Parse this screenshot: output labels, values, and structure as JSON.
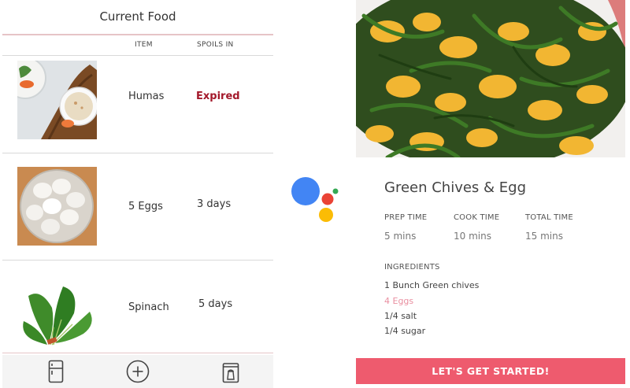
{
  "food_list": {
    "title": "Current Food",
    "columns": {
      "item": "ITEM",
      "spoils_in": "SPOILS IN"
    },
    "rows": [
      {
        "name": "Humas",
        "spoils_in": "Expired",
        "status_color": "#a3182a"
      },
      {
        "name": "5 Eggs",
        "spoils_in": "3 days"
      },
      {
        "name": "Spinach",
        "spoils_in": "5 days"
      }
    ],
    "nav": [
      "fridge-icon",
      "add-circle-icon",
      "trash-bin-icon"
    ]
  },
  "assistant": {
    "icon": "google-assistant-icon",
    "colors": [
      "#4285f4",
      "#ea4335",
      "#fbbc05",
      "#34a853"
    ]
  },
  "recipe": {
    "title": "Green Chives & Egg",
    "prep_label": "PREP TIME",
    "prep_value": "5 mins",
    "cook_label": "COOK TIME",
    "cook_value": "10 mins",
    "total_label": "TOTAL TIME",
    "total_value": "15 mins",
    "ingredients_label": "INGREDIENTS",
    "ingredients": [
      "1 Bunch Green chives",
      "4 Eggs",
      "1/4 salt",
      "1/4 sugar"
    ],
    "cta_label": "LET'S GET STARTED!",
    "accent_color": "#ee5b6e"
  }
}
